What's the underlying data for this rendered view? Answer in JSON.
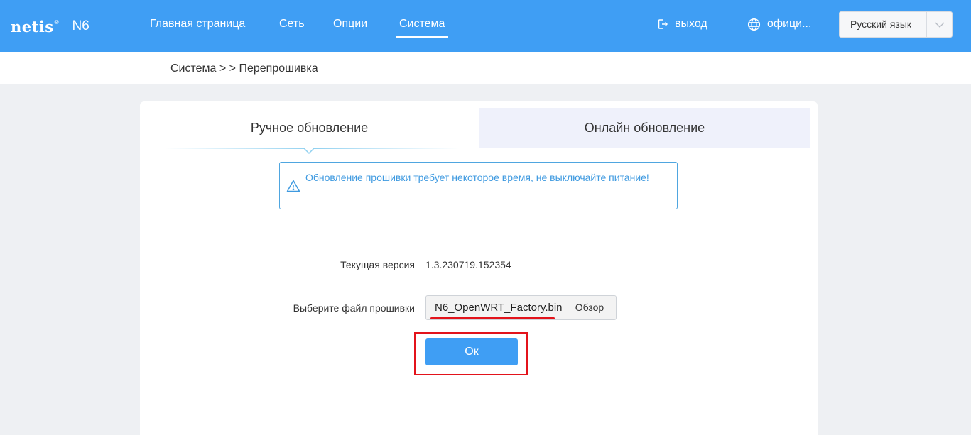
{
  "header": {
    "brand": "netis",
    "brand_mark": "®",
    "model": "N6",
    "nav": [
      {
        "label": "Главная страница"
      },
      {
        "label": "Сеть"
      },
      {
        "label": "Опции"
      },
      {
        "label": "Система",
        "active": true
      }
    ],
    "logout_label": "выход",
    "official_label": "офици...",
    "language": {
      "selected": "Русский язык"
    }
  },
  "breadcrumb": "Система > > Перепрошивка",
  "tabs": {
    "manual": "Ручное обновление",
    "online": "Онлайн обновление",
    "active": "manual"
  },
  "notice": {
    "icon": "warning-icon",
    "text": "Обновление прошивки требует некоторое время, не выключайте питание!"
  },
  "form": {
    "version_label": "Текущая версия",
    "version_value": "1.3.230719.152354",
    "file_label": "Выберите файл прошивки",
    "file_value": "N6_OpenWRT_Factory.bin",
    "browse_label": "Обзор",
    "ok_label": "Ок"
  },
  "colors": {
    "header_bg": "#3f9ef4",
    "accent": "#3f9ef4",
    "notice_text": "#3f9ae0",
    "annotation_red": "#e3131b",
    "inactive_tab_bg": "#eff1fb"
  }
}
